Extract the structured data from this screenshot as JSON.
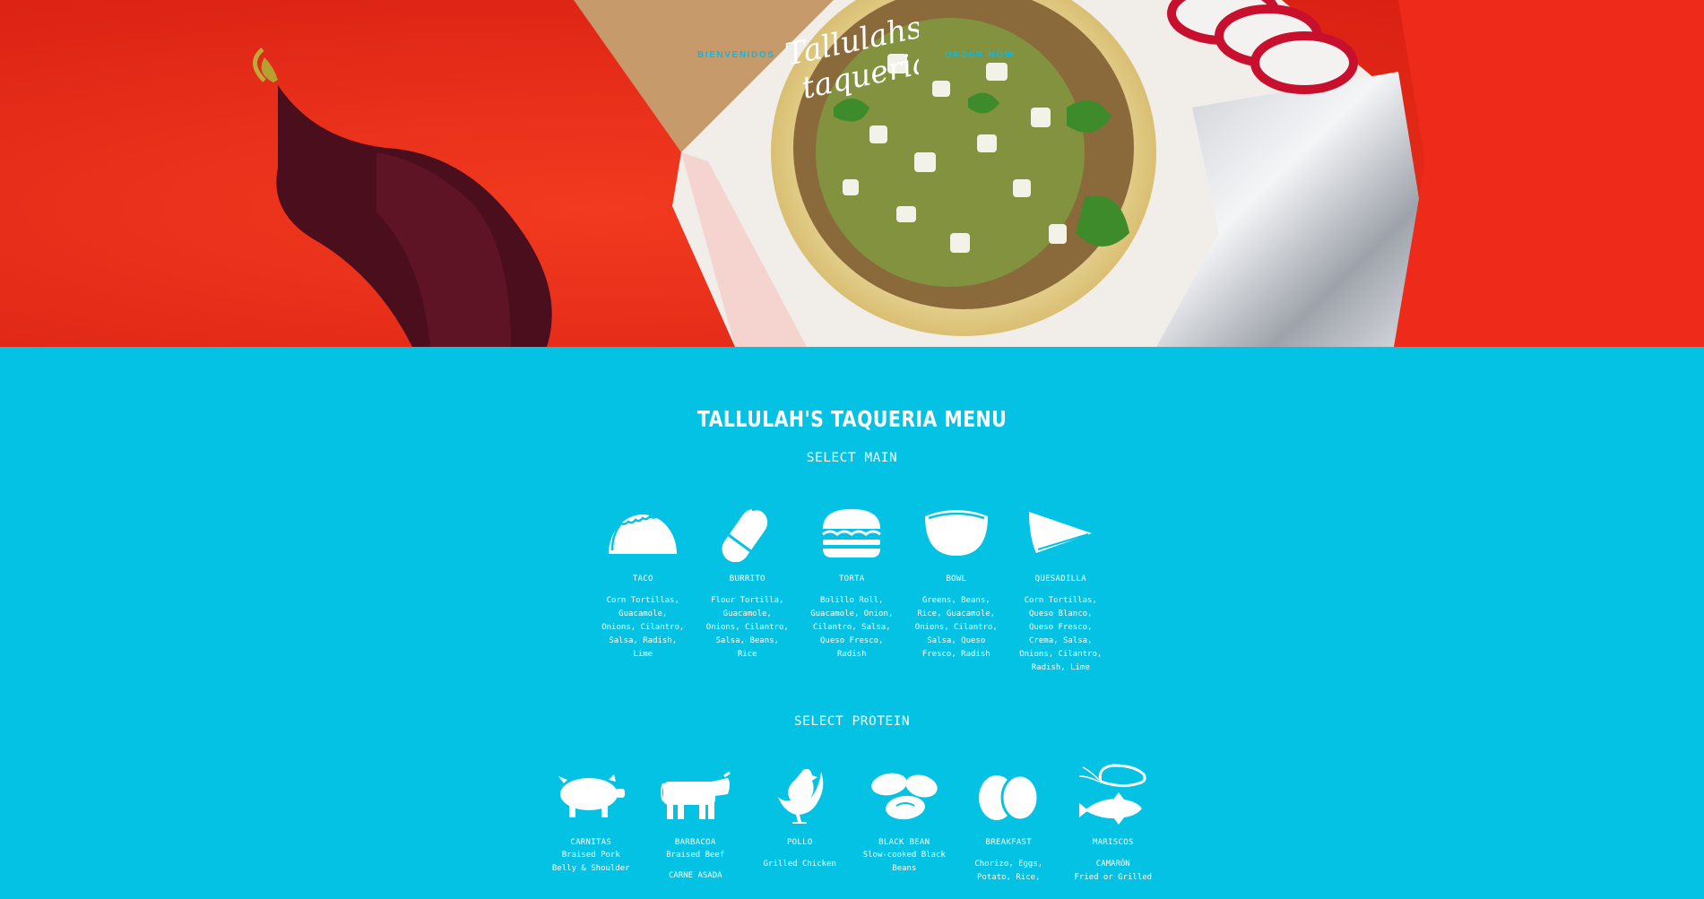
{
  "nav": {
    "left_link": "Bienvenidos",
    "right_link": "Order Now",
    "logo_line1": "Tallulahs",
    "logo_line2": "taqueria"
  },
  "menu": {
    "title": "TALLULAH'S TAQUERIA MENU",
    "main_heading": "SELECT MAIN",
    "protein_heading": "SELECT PROTEIN",
    "mains": [
      {
        "name": "TACO",
        "desc": "Corn Tortillas, Guacamole, Onions, Cilantro, Salsa, Radish, Lime",
        "icon": "taco-icon"
      },
      {
        "name": "BURRITO",
        "desc": "Flour Tortilla, Guacamole, Onions, Cilantro, Salsa, Beans, Rice",
        "icon": "burrito-icon"
      },
      {
        "name": "TORTA",
        "desc": "Bolillo Roll, Guacamole, Onion, Cilantro, Salsa, Queso Fresco, Radish",
        "icon": "sandwich-icon"
      },
      {
        "name": "BOWL",
        "desc": "Greens, Beans, Rice, Guacamole, Onions, Cilantro, Salsa, Queso Fresco, Radish",
        "icon": "bowl-icon"
      },
      {
        "name": "QUESADILLA",
        "desc": "Corn Tortillas, Queso Blanco, Queso Fresco, Crema, Salsa, Onions, Cilantro, Radish, Lime",
        "icon": "quesadilla-icon"
      }
    ],
    "proteins": [
      {
        "name": "CARNITAS",
        "desc": "Braised Pork Belly & Shoulder",
        "icon": "pig-icon"
      },
      {
        "name": "BARBACOA",
        "desc": "Braised Beef",
        "name2": "CARNE ASADA",
        "icon": "cow-icon"
      },
      {
        "name": "POLLO",
        "desc": "Grilled Chicken",
        "icon": "chicken-icon"
      },
      {
        "name": "BLACK BEAN",
        "desc": "Slow-cooked Black Beans",
        "icon": "beans-icon"
      },
      {
        "name": "BREAKFAST",
        "desc": "Chorizo, Eggs, Potato, Rice,",
        "icon": "eggs-icon"
      },
      {
        "name": "MARISCOS",
        "desc": "CAMARÓN",
        "desc2": "Fried or Grilled",
        "icon": "shrimp-fish-icon"
      }
    ]
  },
  "colors": {
    "accent": "#04c2e4",
    "hero_red": "#ef2d1c",
    "nav_link": "#0fb8e0"
  }
}
